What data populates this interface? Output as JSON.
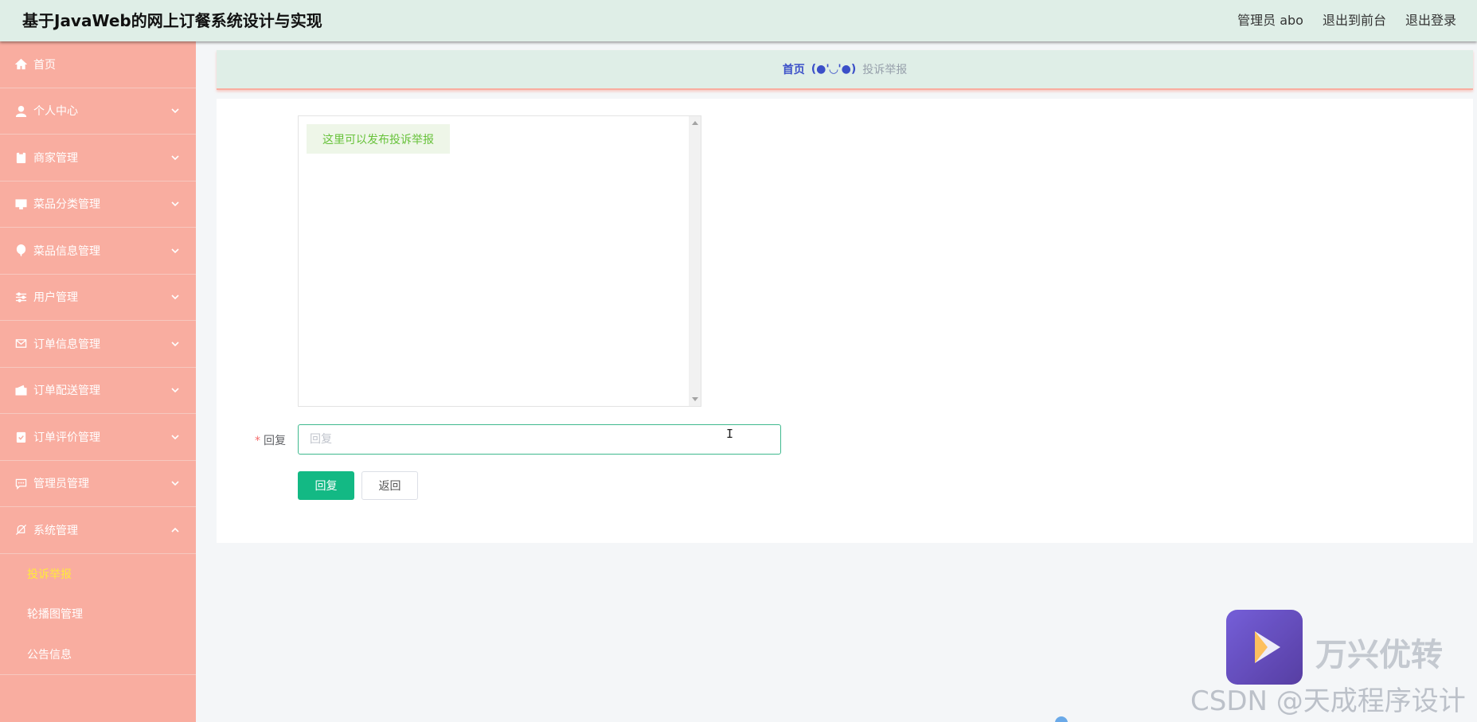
{
  "header": {
    "title": "基于JavaWeb的网上订餐系统设计与实现",
    "user_label": "管理员 abo",
    "to_frontend": "退出到前台",
    "logout": "退出登录"
  },
  "sidebar": {
    "items": [
      {
        "label": "首页",
        "icon": "home-icon"
      },
      {
        "label": "个人中心",
        "icon": "user-icon"
      },
      {
        "label": "商家管理",
        "icon": "clipboard-icon"
      },
      {
        "label": "菜品分类管理",
        "icon": "monitor-icon"
      },
      {
        "label": "菜品信息管理",
        "icon": "balloon-icon"
      },
      {
        "label": "用户管理",
        "icon": "sliders-icon"
      },
      {
        "label": "订单信息管理",
        "icon": "mail-icon"
      },
      {
        "label": "订单配送管理",
        "icon": "wallet-icon"
      },
      {
        "label": "订单评价管理",
        "icon": "checklist-icon"
      },
      {
        "label": "管理员管理",
        "icon": "chat-icon"
      },
      {
        "label": "系统管理",
        "icon": "bell-off-icon"
      }
    ],
    "sub_items": [
      {
        "label": "投诉举报",
        "active": true
      },
      {
        "label": "轮播图管理",
        "active": false
      },
      {
        "label": "公告信息",
        "active": false
      }
    ]
  },
  "breadcrumb": {
    "home": "首页",
    "separator": "(●'◡'●)",
    "current": "投诉举报"
  },
  "chat": {
    "message": "这里可以发布投诉举报"
  },
  "form": {
    "reply_label": "回复",
    "required_mark": "*",
    "reply_value": "",
    "reply_placeholder": "回复",
    "submit_label": "回复",
    "back_label": "返回"
  },
  "watermark": {
    "brand": "万兴优转",
    "credit": "CSDN @天成程序设计"
  },
  "colors": {
    "topbar": "#dfeee7",
    "sidebar": "#f9ada0",
    "accent": "#13b984",
    "active_submenu": "#ffea3b"
  }
}
